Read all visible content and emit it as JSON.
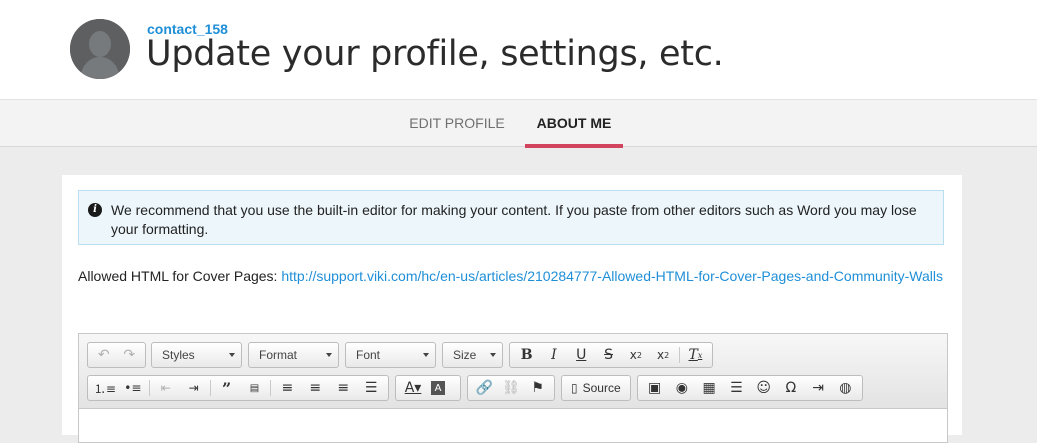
{
  "header": {
    "username": "contact_158",
    "title": "Update your profile, settings, etc."
  },
  "tabs": [
    {
      "label": "EDIT PROFILE",
      "active": false
    },
    {
      "label": "ABOUT ME",
      "active": true
    }
  ],
  "notice": {
    "icon": "info-icon",
    "text": "We recommend that you use the built-in editor for making your content. If you paste from other editors such as Word you may lose your formatting."
  },
  "allowed_html": {
    "label": "Allowed HTML for Cover Pages: ",
    "link": "http://support.viki.com/hc/en-us/articles/210284777-Allowed-HTML-for-Cover-Pages-and-Community-Walls"
  },
  "editor": {
    "combos": {
      "styles": "Styles",
      "format": "Format",
      "font": "Font",
      "size": "Size"
    },
    "source_label": "Source"
  },
  "colors": {
    "accent": "#d2445e",
    "link": "#1f8fd7",
    "info_bg": "#ecf6fb"
  }
}
